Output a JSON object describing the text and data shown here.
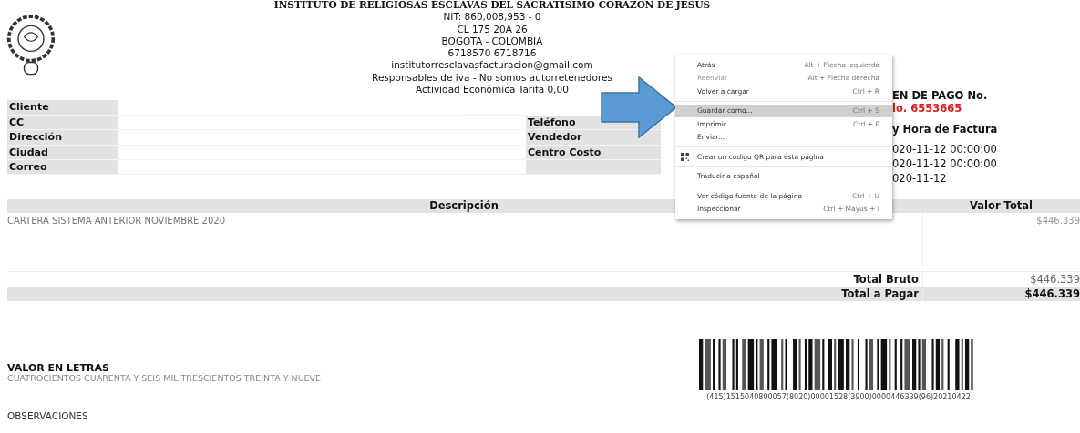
{
  "header": {
    "title": "INSTITUTO DE RELIGIOSAS ESCLAVAS DEL SACRATISIMO CORAZON DE JESUS",
    "lines": [
      "NIT: 860,008,953 - 0",
      "CL 175 20A 26",
      "BOGOTA - COLOMBIA",
      "6718570 6718716",
      "institutorresclavasfacturacion@gmail.com",
      "Responsables de iva - No somos autorretenedores",
      "Actividad Económica Tarifa 0,00"
    ]
  },
  "customer_fields": [
    {
      "label": "Cliente"
    },
    {
      "label": "CC"
    },
    {
      "label": "Dirección"
    },
    {
      "label": "Ciudad"
    },
    {
      "label": "Correo"
    }
  ],
  "sale_fields": [
    {
      "label": "Teléfono"
    },
    {
      "label": "Vendedor"
    },
    {
      "label": "Centro Costo"
    }
  ],
  "payment": {
    "heading": "EN DE PAGO No.",
    "number": "lo. 6553665",
    "date_heading": "y Hora de Factura",
    "dates": [
      "020-11-12 00:00:00",
      "020-11-12 00:00:00",
      "020-11-12"
    ]
  },
  "items_table": {
    "columns": [
      "Descripción",
      "Valor Total"
    ],
    "rows": [
      {
        "description": "CARTERA SISTEMA ANTERIOR NOVIEMBRE 2020",
        "value": "$446.339"
      }
    ]
  },
  "totals": [
    {
      "kind": "plain",
      "label": "Total Bruto",
      "value": "$446.339"
    },
    {
      "kind": "emphasis",
      "label": "Total a Pagar",
      "value": "$446.339"
    }
  ],
  "amount_in_words": {
    "heading": "VALOR EN LETRAS",
    "text": "CUATROCIENTOS CUARENTA Y SEIS MIL TRESCIENTOS TREINTA Y NUEVE"
  },
  "barcode": {
    "caption": "(415)1515040800057(8020)00001528(3900)0000446339(96)20210422"
  },
  "observations": {
    "heading": "OBSERVACIONES"
  },
  "context_menu": {
    "items": [
      {
        "kind": "item",
        "label": "Atrás",
        "shortcut": "Alt + Flecha izquierda",
        "disabled": false,
        "selected": false
      },
      {
        "kind": "item",
        "label": "Reenviar",
        "shortcut": "Alt + Flecha derecha",
        "disabled": true,
        "selected": false
      },
      {
        "kind": "item",
        "label": "Volver a cargar",
        "shortcut": "Ctrl + R",
        "disabled": false,
        "selected": false
      },
      {
        "kind": "separator"
      },
      {
        "kind": "item",
        "label": "Guardar como...",
        "shortcut": "Ctrl + S",
        "disabled": false,
        "selected": true
      },
      {
        "kind": "item",
        "label": "Imprimir...",
        "shortcut": "Ctrl + P",
        "disabled": false,
        "selected": false
      },
      {
        "kind": "item",
        "label": "Enviar...",
        "disabled": false,
        "selected": false
      },
      {
        "kind": "separator"
      },
      {
        "kind": "icon_item",
        "label": "Crear un código QR para esta página",
        "disabled": false,
        "selected": false
      },
      {
        "kind": "separator"
      },
      {
        "kind": "item",
        "label": "Traducir a español",
        "disabled": false,
        "selected": false
      },
      {
        "kind": "separator"
      },
      {
        "kind": "item",
        "label": "Ver código fuente de la página",
        "shortcut": "Ctrl + U",
        "disabled": false,
        "selected": false
      },
      {
        "kind": "item",
        "label": "Inspeccionar",
        "shortcut": "Ctrl + Mayús + I",
        "disabled": false,
        "selected": false
      }
    ]
  }
}
